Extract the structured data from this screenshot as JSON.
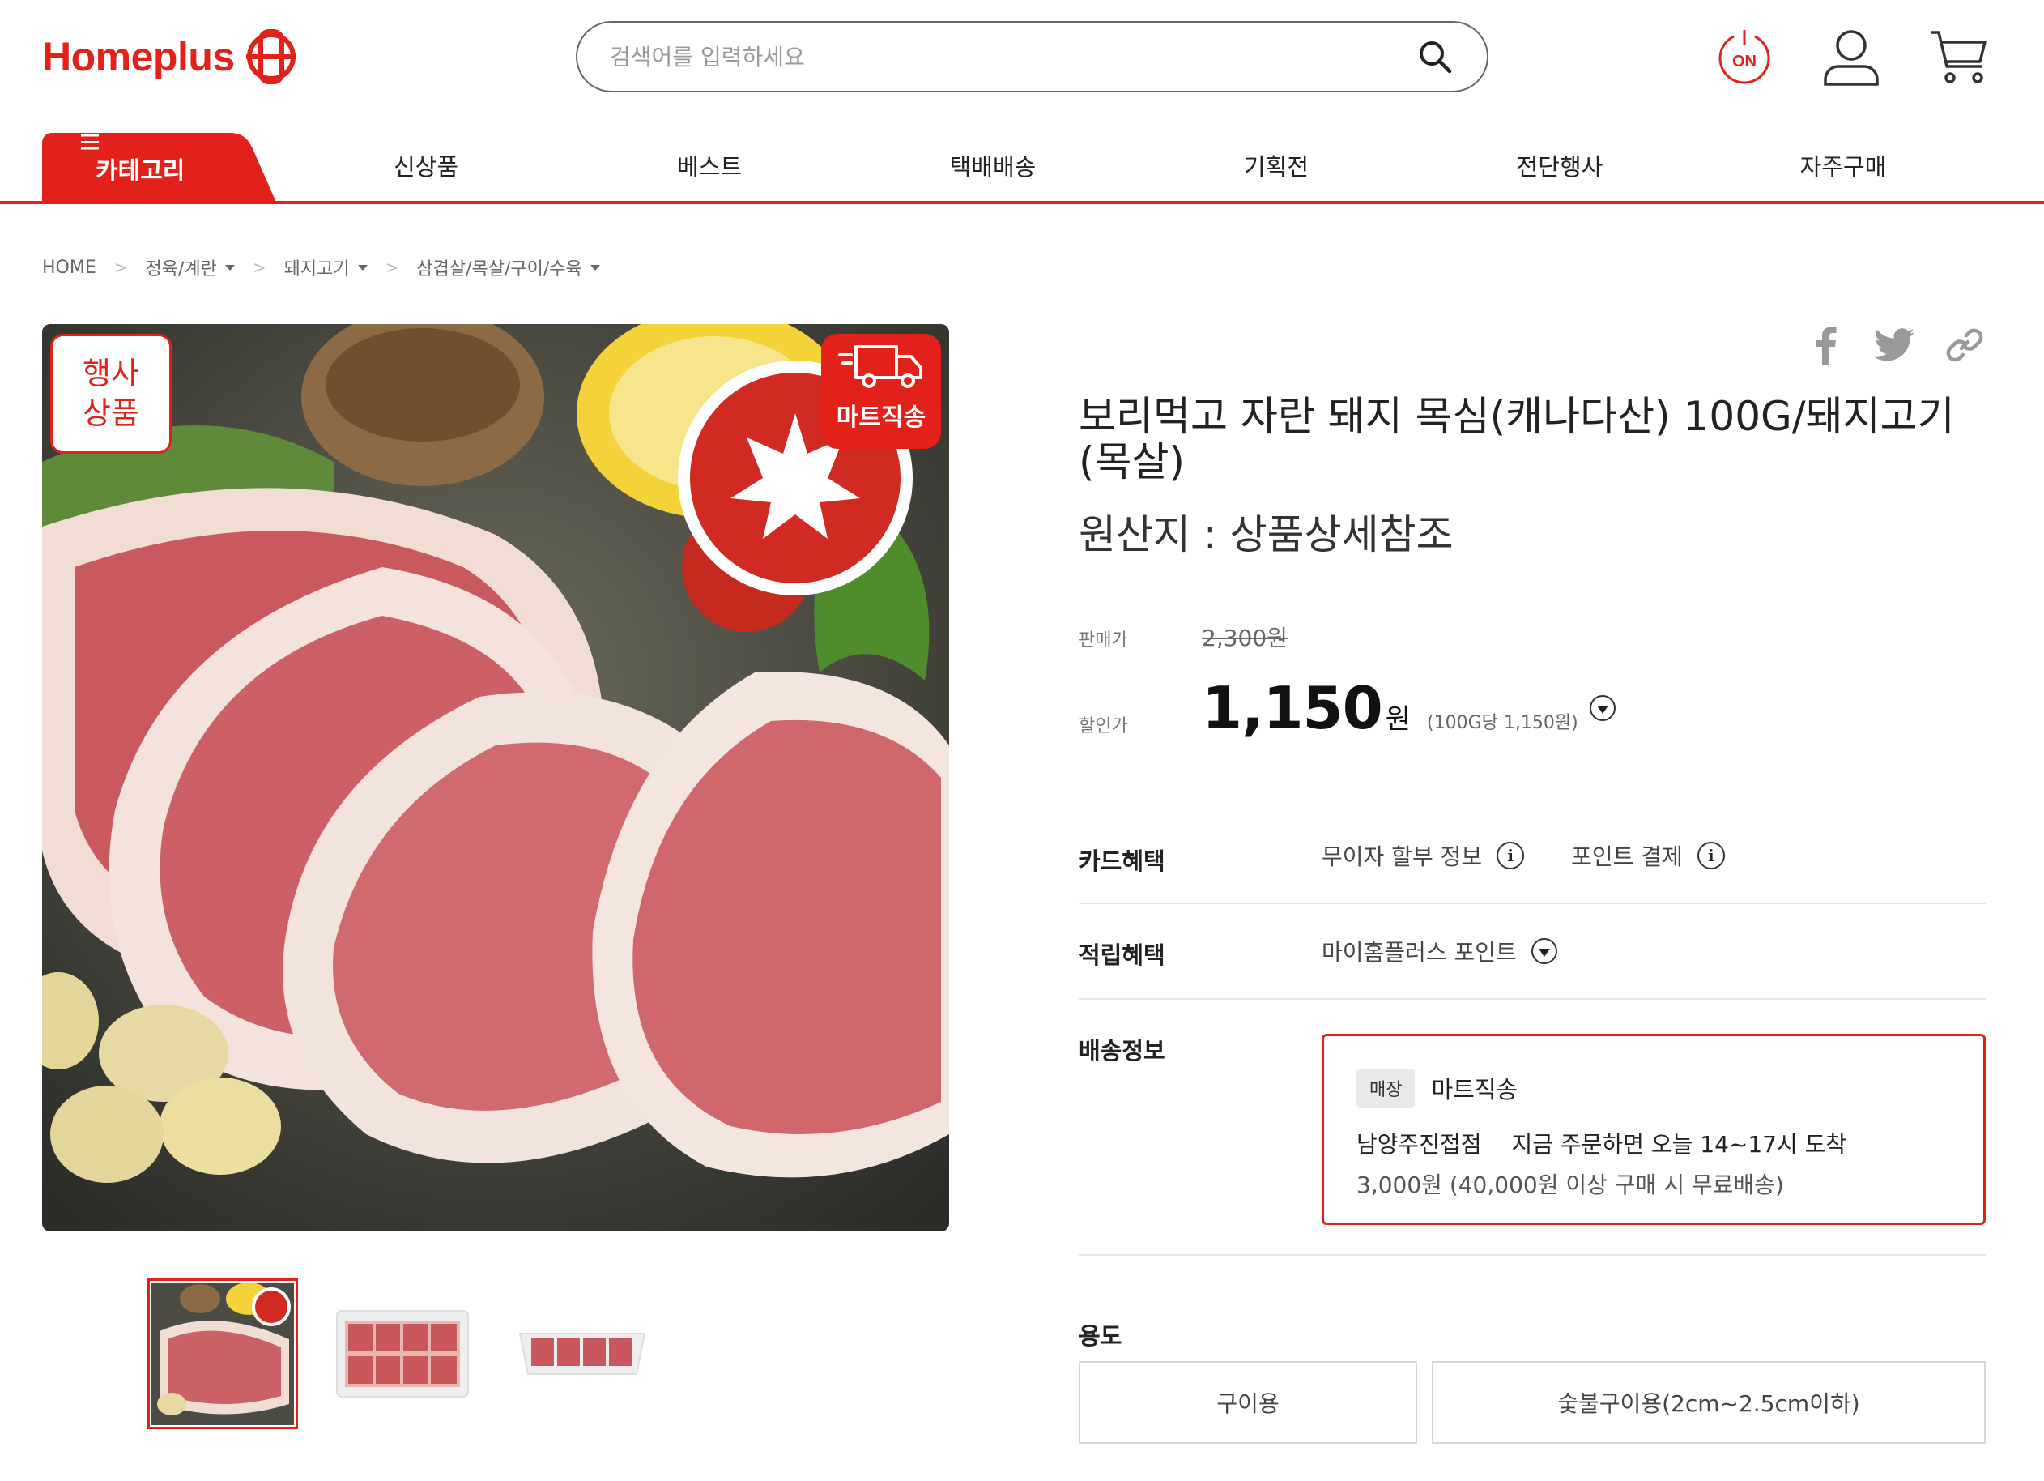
{
  "header": {
    "logo_text": "Homeplus",
    "search_placeholder": "검색어를 입력하세요",
    "on_label": "ON",
    "brand_color": "#e1211a"
  },
  "gnb": {
    "category_label": "카테고리",
    "items": [
      "신상품",
      "베스트",
      "택배배송",
      "기획전",
      "전단행사",
      "자주구매"
    ]
  },
  "breadcrumb": {
    "home": "HOME",
    "items": [
      "정육/계란",
      "돼지고기",
      "삼겹살/목살/구이/수육"
    ]
  },
  "image": {
    "event_badge_line1": "행사",
    "event_badge_line2": "상품",
    "direct_badge": "마트직송",
    "thumbnail_count": 3
  },
  "product": {
    "title": "보리먹고 자란 돼지 목심(캐나다산) 100G/돼지고기(목살)",
    "origin": "원산지 : 상품상세참조",
    "price_label": "판매가",
    "original_price": "2,300원",
    "sale_label": "할인가",
    "sale_price": "1,150",
    "sale_currency": "원",
    "unit_price": "(100G당 1,150원)"
  },
  "benefits": {
    "card_label": "카드혜택",
    "card_items": [
      "무이자 할부 정보",
      "포인트 결제"
    ],
    "point_label": "적립혜택",
    "point_value": "마이홈플러스 포인트",
    "delivery_label": "배송정보"
  },
  "delivery": {
    "store_tag": "매장",
    "method": "마트직송",
    "store_name": "남양주진접점",
    "eta": "지금 주문하면 오늘 14~17시 도착",
    "fee": "3,000원  (40,000원 이상 구매 시 무료배송)"
  },
  "usage": {
    "label": "용도",
    "options": [
      "구이용",
      "숯불구이용(2cm~2.5cm이하)"
    ]
  }
}
